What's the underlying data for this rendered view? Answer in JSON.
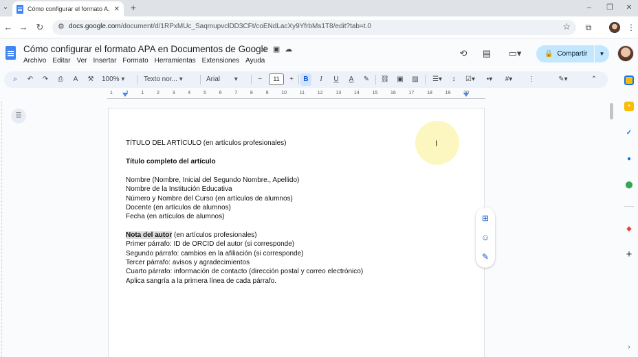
{
  "browser": {
    "tab_title": "Cómo configurar el formato A...",
    "tab_close": "✕",
    "new_tab": "+",
    "url_host": "docs.google.com",
    "url_path": "/document/d/1RPxMUc_SaqmupvclDD3CFt/coENdLacXy9YfrbMs1T8/edit?tab=t.0",
    "window_controls": {
      "minimize": "–",
      "restore": "❐",
      "close": "✕"
    }
  },
  "doc": {
    "title": "Cómo configurar el formato APA en Documentos de Google",
    "menu": [
      "Archivo",
      "Editar",
      "Ver",
      "Insertar",
      "Formato",
      "Herramientas",
      "Extensiones",
      "Ayuda"
    ],
    "share_label": "Compartir"
  },
  "toolbar": {
    "zoom": "100%",
    "style": "Texto nor...",
    "font": "Arial",
    "font_size": "11"
  },
  "ruler": {
    "labels": [
      "1",
      "2",
      "1",
      "2",
      "3",
      "4",
      "5",
      "6",
      "7",
      "8",
      "9",
      "10",
      "11",
      "12",
      "13",
      "14",
      "15",
      "16",
      "17",
      "18",
      "19",
      "20"
    ]
  },
  "content": {
    "line1": "TÍTULO DEL ARTÍCULO (en artículos profesionales)",
    "line2": "Título completo del artículo",
    "line3": "Nombre (Nombre, Inicial del Segundo Nombre., Apellido)",
    "line4": "Nombre de la Institución Educativa",
    "line5": "Número y Nombre del Curso (en artículos de alumnos)",
    "line6": "Docente (en artículos de alumnos)",
    "line7": "Fecha (en artículos de alumnos)",
    "line8_highlight": "Nota del autor",
    "line8_rest": " (en artículos profesionales)",
    "line9": "Primer párrafo: ID de ORCID del autor (si corresponde)",
    "line10": "Segundo párrafo: cambios en la afiliación (si corresponde)",
    "line11": "Tercer párrafo: avisos y agradecimientos",
    "line12": "Cuarto párrafo: información de contacto (dirección postal y correo electrónico)",
    "line13": "Aplica sangría a la primera línea de cada párrafo."
  },
  "colors": {
    "accent": "#0b57d0",
    "share_bg": "#c2e7ff",
    "toolbar_bg": "#edf2fa",
    "docs_blue": "#4285f4"
  }
}
